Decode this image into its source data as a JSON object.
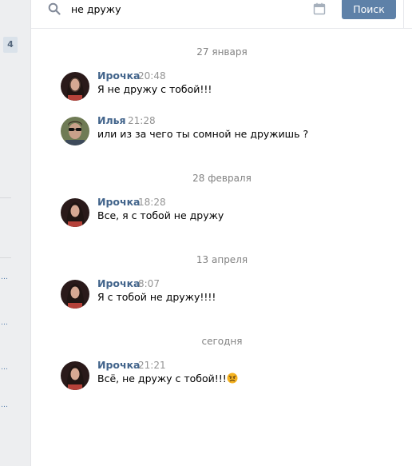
{
  "sidebar": {
    "counter": "4",
    "dots": [
      "…",
      "…",
      "…",
      "…",
      "…"
    ]
  },
  "search": {
    "query": "не дружу",
    "button_label": "Поиск",
    "search_icon": "search-icon",
    "calendar_icon": "calendar-icon"
  },
  "colors": {
    "accent": "#5e81a8",
    "author": "#42648b",
    "muted": "#939393"
  },
  "dates": [
    "27 января",
    "28 февраля",
    "13 апреля",
    "сегодня"
  ],
  "messages": [
    {
      "author": "Ирочка",
      "time": "20:48",
      "text": "Я не дружу с тобой!!!"
    },
    {
      "author": "Илья",
      "time": "21:28",
      "text": "или из за чего ты сомной не дружишь ?"
    },
    {
      "author": "Ирочка",
      "time": "18:28",
      "text": "Все, я с тобой не дружу"
    },
    {
      "author": "Ирочка",
      "time": "8:07",
      "text": "Я с тобой не дружу!!!!"
    },
    {
      "author": "Ирочка",
      "time": "21:21",
      "text": "Всё, не дружу с тобой!!!",
      "emoji": "angry-face-icon"
    }
  ]
}
